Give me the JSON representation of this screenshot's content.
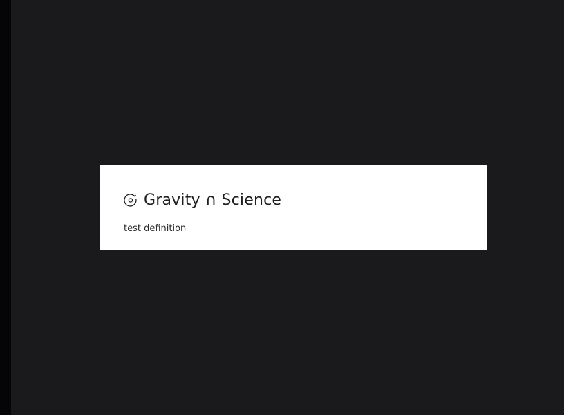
{
  "card": {
    "icon": "gravity-science-icon",
    "title": "Gravity ∩ Science",
    "definition": "test definition"
  },
  "colors": {
    "background": "#1a1a1c",
    "left_edge": "#050507",
    "card_background": "#ffffff",
    "title_text": "#1f1f1f",
    "definition_text": "#2b2b2b"
  }
}
